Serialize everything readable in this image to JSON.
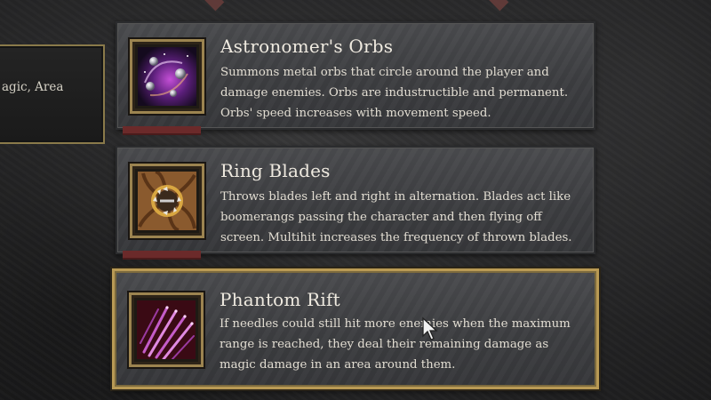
{
  "side_panel": {
    "text": "agic, Area"
  },
  "cards": [
    {
      "title": "Astronomer's Orbs",
      "description": "Summons metal orbs that circle around the player and damage enemies. Orbs are industructible and permanent. Orbs' speed increases with movement speed.",
      "icon": "orbs-icon",
      "selected": false
    },
    {
      "title": "Ring Blades",
      "description": "Throws blades left and right in alternation. Blades act like boomerangs passing the character and then flying off screen. Multihit increases the frequency of thrown blades.",
      "icon": "ring-blades-icon",
      "selected": false
    },
    {
      "title": "Phantom Rift",
      "description": "If needles could still hit more enemies when the maximum range is reached, they deal their remaining damage as magic damage in an area around them.",
      "icon": "phantom-rift-icon",
      "selected": true
    }
  ],
  "colors": {
    "frame_gold": "#b99a55",
    "card_bg": "#404144",
    "accent_red": "#6b2a2a"
  }
}
